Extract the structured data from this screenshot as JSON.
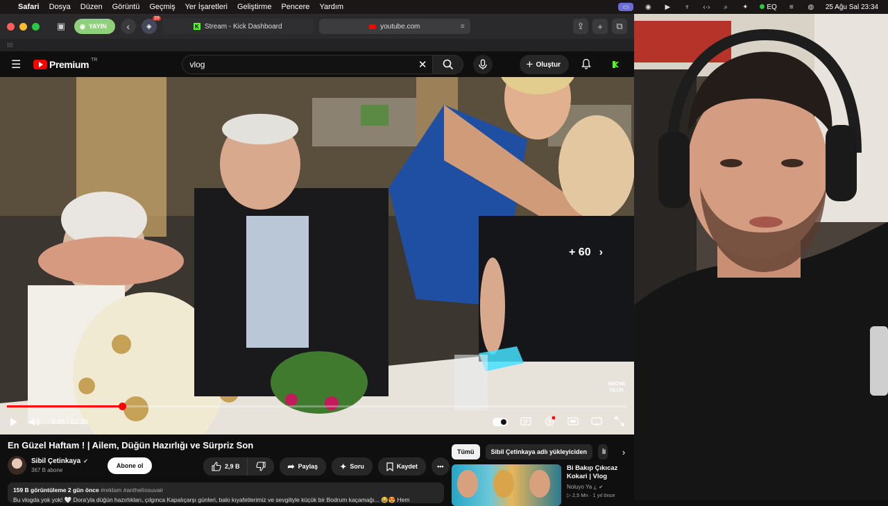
{
  "menubar": {
    "app": "Safari",
    "items": [
      "Dosya",
      "Düzen",
      "Görüntü",
      "Geçmiş",
      "Yer İşaretleri",
      "Geliştirme",
      "Pencere",
      "Yardım"
    ],
    "eq_label": "EQ",
    "datetime": "25 Ağu Sal  23:34"
  },
  "browser": {
    "yayin_label": "YAYIN",
    "ext_badge": "39",
    "tabs": [
      {
        "label": "Stream - Kick Dashboard"
      },
      {
        "label": "youtube.com"
      }
    ]
  },
  "youtube": {
    "logo_word": "Premium",
    "logo_region": "TR",
    "search_value": "vlog",
    "create_label": "Oluştur"
  },
  "player": {
    "current_time": "9:49",
    "duration": "52:39",
    "time_display": "9:49 / 52:39",
    "progress_fraction": 0.186,
    "skip_label": "+ 60",
    "watermark_line1": "ABONE",
    "watermark_line2": "OLUN"
  },
  "video": {
    "title": "En Güzel Haftam ! | Ailem, Düğün Hazırlığı ve Sürpriz Son",
    "channel_name": "Sibil Çetinkaya",
    "channel_subs": "367 B abone",
    "subscribe_label": "Abone ol",
    "likes": "2,9 B",
    "share_label": "Paylaş",
    "ask_label": "Soru",
    "save_label": "Kaydet",
    "desc_meta": "159 B görüntüleme  2 gün önce",
    "desc_tags": "#reklam #anthelíosuvair",
    "desc_line2": "Bu vlogda yok yok! 🤍 Dora'yla düğün hazırlıkları, çılgınca Kapalıçarşı günleri, balo kıyafetlerimiz ve sevgiliyle küçük bir Bodrum kaçamağı... 😂😍 Hem"
  },
  "sidebar": {
    "chips": [
      "Tümü",
      "Sibil Çetinkaya adlı yükleyiciden",
      "İl"
    ],
    "rec": {
      "title": "Bi Bakıp Çıkıcaz Kokari | Vlog",
      "channel": "Noluyo Ya ¿",
      "meta": "▷ 2,5 Mn · 1 yıl önce"
    }
  }
}
